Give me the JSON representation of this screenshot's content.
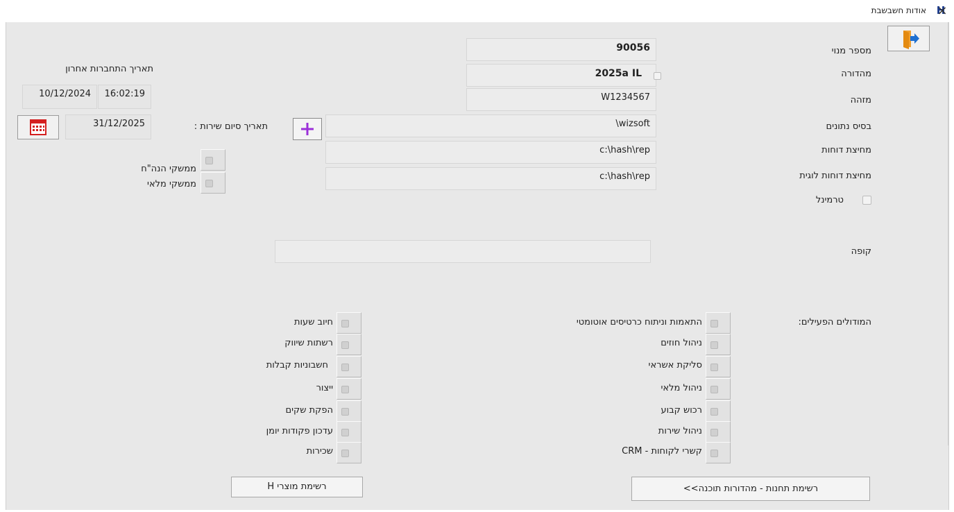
{
  "window": {
    "title": "אודות חשבשבת",
    "icon_letter": "H",
    "close_label": "×"
  },
  "fields": {
    "subscriber_label": "מספר מנוי",
    "subscriber_value": "90056",
    "version_label": "מהדורה",
    "version_value": "2025a IL",
    "id_label": "מזהה",
    "id_value": "W1234567",
    "database_label": "בסיס נתונים",
    "database_value": "\\wizsoft",
    "reports_folder_label": "מחיצת דוחות",
    "reports_folder_value": "c:\\hash\\rep",
    "logical_reports_label": "מחיצת דוחות לוגית",
    "logical_reports_value": "c:\\hash\\rep",
    "terminal_label": "טרמינל",
    "register_label": "קופה",
    "register_value": ""
  },
  "last_login": {
    "label": "תאריך התחברות אחרון",
    "date": "10/12/2024",
    "time": "16:02:19"
  },
  "service": {
    "label": "תאריך סיום שירות :",
    "end_date": "31/12/2025",
    "plus_label": "+"
  },
  "interfaces": [
    {
      "label": "ממשקי הנה\"ח"
    },
    {
      "label": "ממשקי מלאי"
    }
  ],
  "modules": {
    "title": "המודולים הפעילים:",
    "col_right": [
      "התאמות וניתוח כרטיסים אוטומטי",
      "ניהול חוזים",
      "סליקת אשראי",
      "ניהול מלאי",
      "רכוש קבוע",
      "ניהול שירות",
      "קשרי לקוחות - CRM"
    ],
    "col_left": [
      "חיוב שעות",
      "רשתות שיווק",
      "חשבוניות קבלות",
      "ייצור",
      "הפקת שקים",
      "עדכון פקודות יומן",
      "שכירות"
    ]
  },
  "buttons": {
    "stations": "רשימת תחנות - מהדורות תוכנה>>",
    "products": "רשימת מוצרי H"
  },
  "colors": {
    "plus": "#9b30d9",
    "exit_door": "#f0a030",
    "exit_arrow": "#1e6fd0",
    "calendar": "#d42020"
  }
}
